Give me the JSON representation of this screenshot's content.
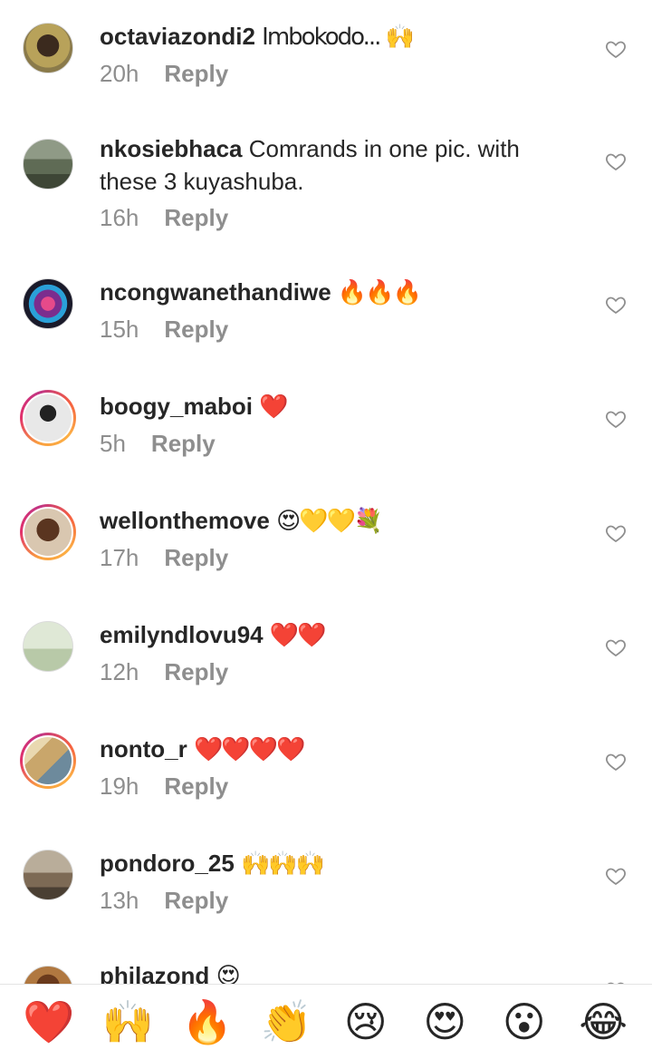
{
  "comments": [
    {
      "username": "octaviazondi2",
      "text": "Imbokodo... 🙌",
      "time": "20h",
      "reply": "Reply",
      "avatar_color": "#8a7a4a"
    },
    {
      "username": "nkosiebhaca",
      "text": "Comrands in one pic. with these 3 kuyashuba.",
      "time": "16h",
      "reply": "Reply",
      "avatar_color": "#5f6b55"
    },
    {
      "username": "ncongwanethandiwe",
      "text": "🔥🔥🔥",
      "time": "15h",
      "reply": "Reply",
      "avatar_color": "#7b2d8e"
    },
    {
      "username": "boogy_maboi",
      "text": "❤️",
      "time": "5h",
      "reply": "Reply",
      "avatar_color": "#3a3a3a"
    },
    {
      "username": "wellonthemove",
      "text": "😍💛💛💐",
      "time": "17h",
      "reply": "Reply",
      "avatar_color": "#9b6a3c"
    },
    {
      "username": "emilyndlovu94",
      "text": "❤️❤️",
      "time": "12h",
      "reply": "Reply",
      "avatar_color": "#b8c9a8"
    },
    {
      "username": "nonto_r",
      "text": "❤️❤️❤️❤️",
      "time": "19h",
      "reply": "Reply",
      "avatar_color": "#c9a66b"
    },
    {
      "username": "pondoro_25",
      "text": "🙌🙌🙌",
      "time": "13h",
      "reply": "Reply",
      "avatar_color": "#7d6a55"
    },
    {
      "username": "philazond",
      "text": "😍",
      "time": "",
      "reply": "",
      "avatar_color": "#b07840"
    }
  ],
  "emoji_bar": [
    "❤️",
    "🙌",
    "🔥",
    "👏",
    "😢",
    "😍",
    "😮",
    "😂"
  ],
  "colors": {
    "text": "#262626",
    "meta": "#8e8e8e",
    "heart_outline": "#8e8e8e"
  }
}
